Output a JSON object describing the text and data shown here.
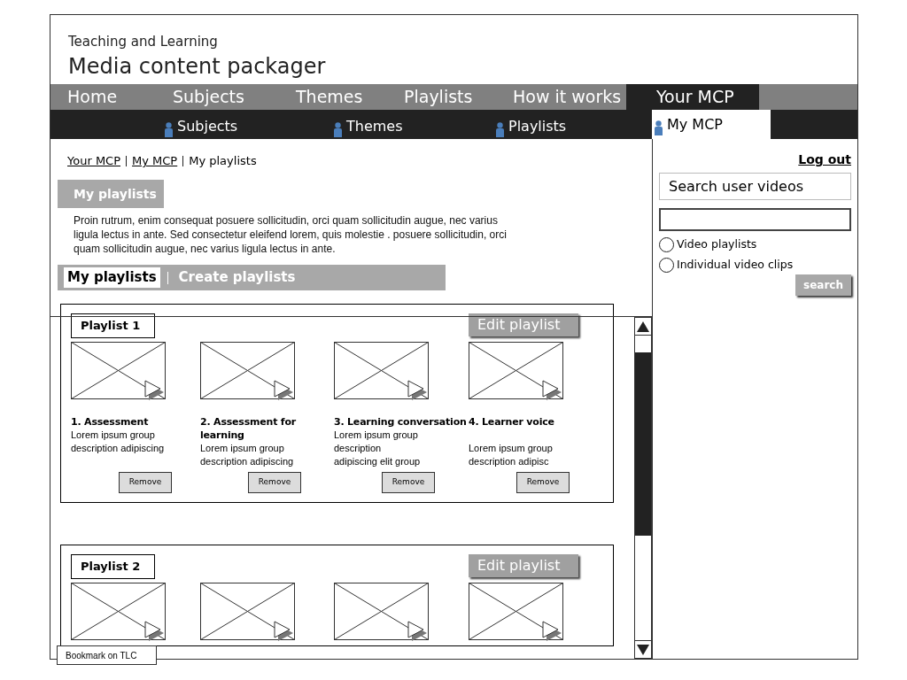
{
  "header": {
    "subtitle": "Teaching and Learning",
    "title": "Media content packager"
  },
  "nav": [
    {
      "label": "Home",
      "selected": false
    },
    {
      "label": "Subjects",
      "selected": false
    },
    {
      "label": "Themes",
      "selected": false
    },
    {
      "label": "Playlists",
      "selected": false
    },
    {
      "label": "How it works",
      "selected": false
    },
    {
      "label": "Your MCP",
      "selected": true
    }
  ],
  "subnav": [
    {
      "label": "Subjects",
      "selected": false
    },
    {
      "label": "Themes",
      "selected": false
    },
    {
      "label": "Playlists",
      "selected": false
    },
    {
      "label": "My MCP",
      "selected": true
    }
  ],
  "breadcrumb": [
    {
      "label": "Your MCP",
      "kind": "link"
    },
    {
      "label": "My MCP",
      "kind": "link"
    },
    {
      "label": "My playlists",
      "kind": "current"
    }
  ],
  "section_heading": "My playlists",
  "description": "Proin rutrum, enim consequat posuere sollicitudin, orci quam sollicitudin augue, nec varius ligula lectus in ante. Sed consectetur eleifend lorem, quis molestie . posuere sollicitudin, orci quam sollicitudin augue, nec varius ligula lectus in ante.",
  "view_tabs": [
    {
      "label": "My playlists",
      "selected": true
    },
    {
      "label": "Create playlists",
      "selected": false
    }
  ],
  "playlists": [
    {
      "title": "Playlist 1",
      "edit_label": "Edit playlist",
      "videos": [
        {
          "title": "1. Assessment",
          "description": "Lorem ipsum group description adipiscing",
          "remove_label": "Remove"
        },
        {
          "title": "2. Assessment for learning",
          "description": "Lorem ipsum group description adipiscing",
          "remove_label": "Remove"
        },
        {
          "title": "3. Learning conversation",
          "description": "Lorem ipsum group description\nadipiscing elit group",
          "remove_label": "Remove"
        },
        {
          "title": "4. Learner voice",
          "description": "\nLorem ipsum group description adipisc",
          "remove_label": "Remove"
        }
      ]
    },
    {
      "title": "Playlist 2",
      "edit_label": "Edit playlist",
      "videos": [
        {
          "kind": "video"
        },
        {
          "kind": "video"
        },
        {
          "kind": "video"
        },
        {
          "kind": "video"
        }
      ]
    }
  ],
  "sidebar": {
    "logout": "Log out",
    "search_label": "Search user videos",
    "radios": [
      {
        "label": "Video playlists",
        "selected": false
      },
      {
        "label": "Individual video clips",
        "selected": false
      }
    ],
    "search_button": "search"
  },
  "bookmark": "Bookmark on TLC"
}
